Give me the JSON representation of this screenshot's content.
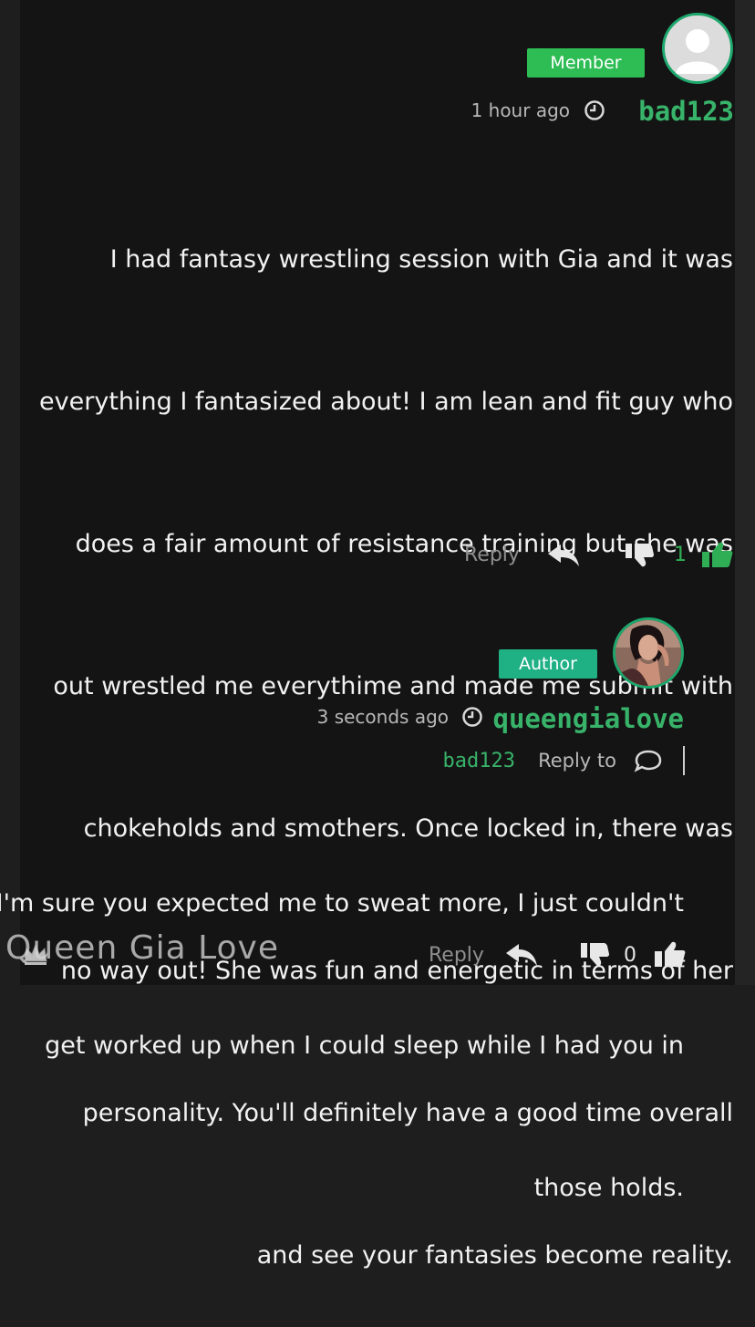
{
  "comments": [
    {
      "username": "bad123",
      "badge": "Member",
      "time": "1 hour ago",
      "text_lines": [
        "I had fantasy wrestling session with Gia and it was",
        "everything I fantasized about! I am lean and fit guy who",
        "does a fair amount of resistance training but she was",
        "out wrestled me everythime and made me submit with",
        "chokeholds and smothers. Once locked in, there was",
        "no way out! She was fun and energetic in terms of her",
        "personality. You'll definitely have a good time overall",
        "and see your fantasies become reality."
      ],
      "likes": "1",
      "reply_label": "Reply"
    },
    {
      "username": "queengialove",
      "badge": "Author",
      "time": "3 seconds ago",
      "reply_to_label": "Reply to",
      "reply_to_user": "bad123",
      "text_lines": [
        "I'm sure you expected me to sweat more, I just couldn't",
        "get worked up when I could sleep while I had you in",
        "those holds."
      ],
      "likes": "0",
      "reply_label": "Reply"
    }
  ],
  "watermark": "Queen Gia Love",
  "icons": {
    "avatar_default": "default-user-avatar-icon",
    "avatar_author": "author-profile-photo",
    "clock": "clock-icon",
    "thumbs_up": "thumbs-up-icon",
    "thumbs_down": "thumbs-down-icon",
    "reply": "reply-arrow-icon",
    "reply_to": "speech-bubble-icon",
    "watermark_logo": "crown-logo-icon"
  },
  "colors": {
    "accent_green": "#38b36a",
    "member_badge": "#2ebd54",
    "author_badge": "#1fb083",
    "background": "#141414"
  }
}
